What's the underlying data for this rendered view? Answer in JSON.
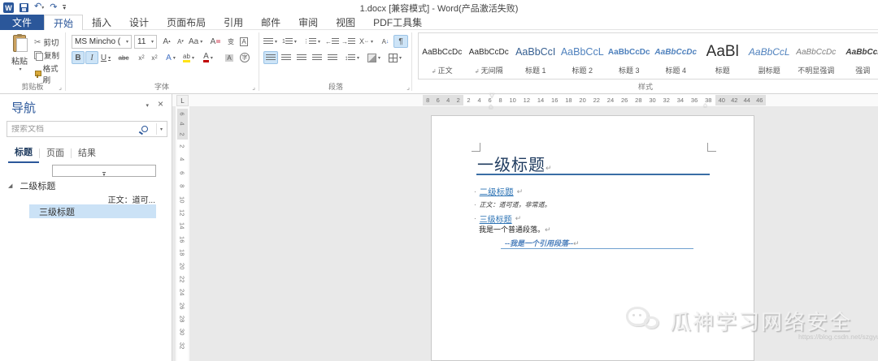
{
  "titlebar": {
    "title": "1.docx [兼容模式] - Word(产品激活失败)"
  },
  "tabs": {
    "file": "文件",
    "active": "开始",
    "items": [
      "开始",
      "插入",
      "设计",
      "页面布局",
      "引用",
      "邮件",
      "审阅",
      "视图",
      "PDF工具集"
    ]
  },
  "ribbon": {
    "clipboard": {
      "label": "剪贴板",
      "paste": "粘贴",
      "cut": "剪切",
      "copy": "复制",
      "format_painter": "格式刷"
    },
    "font": {
      "label": "字体",
      "name": "MS Mincho (",
      "size": "11"
    },
    "paragraph": {
      "label": "段落"
    },
    "styles": {
      "label": "样式",
      "items": [
        {
          "preview": "AaBbCcDc",
          "name": "正文",
          "kind": "normal",
          "marked": true
        },
        {
          "preview": "AaBbCcDc",
          "name": "无间隔",
          "kind": "nospace",
          "marked": true
        },
        {
          "preview": "AaBbCcI",
          "name": "标题 1",
          "kind": "h1"
        },
        {
          "preview": "AaBbCcL",
          "name": "标题 2",
          "kind": "h2"
        },
        {
          "preview": "AaBbCcDc",
          "name": "标题 3",
          "kind": "h3"
        },
        {
          "preview": "AaBbCcDc",
          "name": "标题 4",
          "kind": "h4"
        },
        {
          "preview": "AaBl",
          "name": "标题",
          "kind": "title"
        },
        {
          "preview": "AaBbCcL",
          "name": "副标题",
          "kind": "subtitle"
        },
        {
          "preview": "AaBbCcDc",
          "name": "不明显强调",
          "kind": "subtle"
        },
        {
          "preview": "AaBbCcI",
          "name": "强调",
          "kind": "emphasis"
        }
      ]
    }
  },
  "ruler": {
    "h_left": [
      "8",
      "6",
      "4",
      "2"
    ],
    "h_mid": [
      "2",
      "4",
      "6",
      "8",
      "10",
      "12",
      "14",
      "16",
      "18",
      "20",
      "22",
      "24",
      "26",
      "28",
      "30",
      "32",
      "34",
      "36",
      "38"
    ],
    "h_right": [
      "40",
      "42",
      "44",
      "46"
    ],
    "v_top": [
      "6",
      "4",
      "2"
    ],
    "v_mid": [
      "2",
      "4",
      "6",
      "8",
      "10",
      "12",
      "14",
      "16",
      "18",
      "20",
      "22",
      "24",
      "26",
      "28",
      "30",
      "32"
    ]
  },
  "nav": {
    "title": "导航",
    "search_placeholder": "搜索文档",
    "tabs": [
      "标题",
      "页面",
      "结果"
    ],
    "active_tab": "标题",
    "heading2": "二级标题",
    "preview": "正文：道可...",
    "heading3": "三级标题"
  },
  "document": {
    "h1": "一级标题",
    "h2": "二级标题",
    "body1": "正文：道可道，非常道。",
    "h3": "三级标题",
    "body2": "我是一个普通段落。",
    "quote": "--我是一个引用段落--"
  },
  "watermark": {
    "brand": "瓜神学习网络安全",
    "url": "https://blog.csdn.net/szgyunyun"
  },
  "colors": {
    "accent": "#2b579a",
    "heading_blue": "#2e74b5",
    "selection": "#cbe2f6"
  }
}
